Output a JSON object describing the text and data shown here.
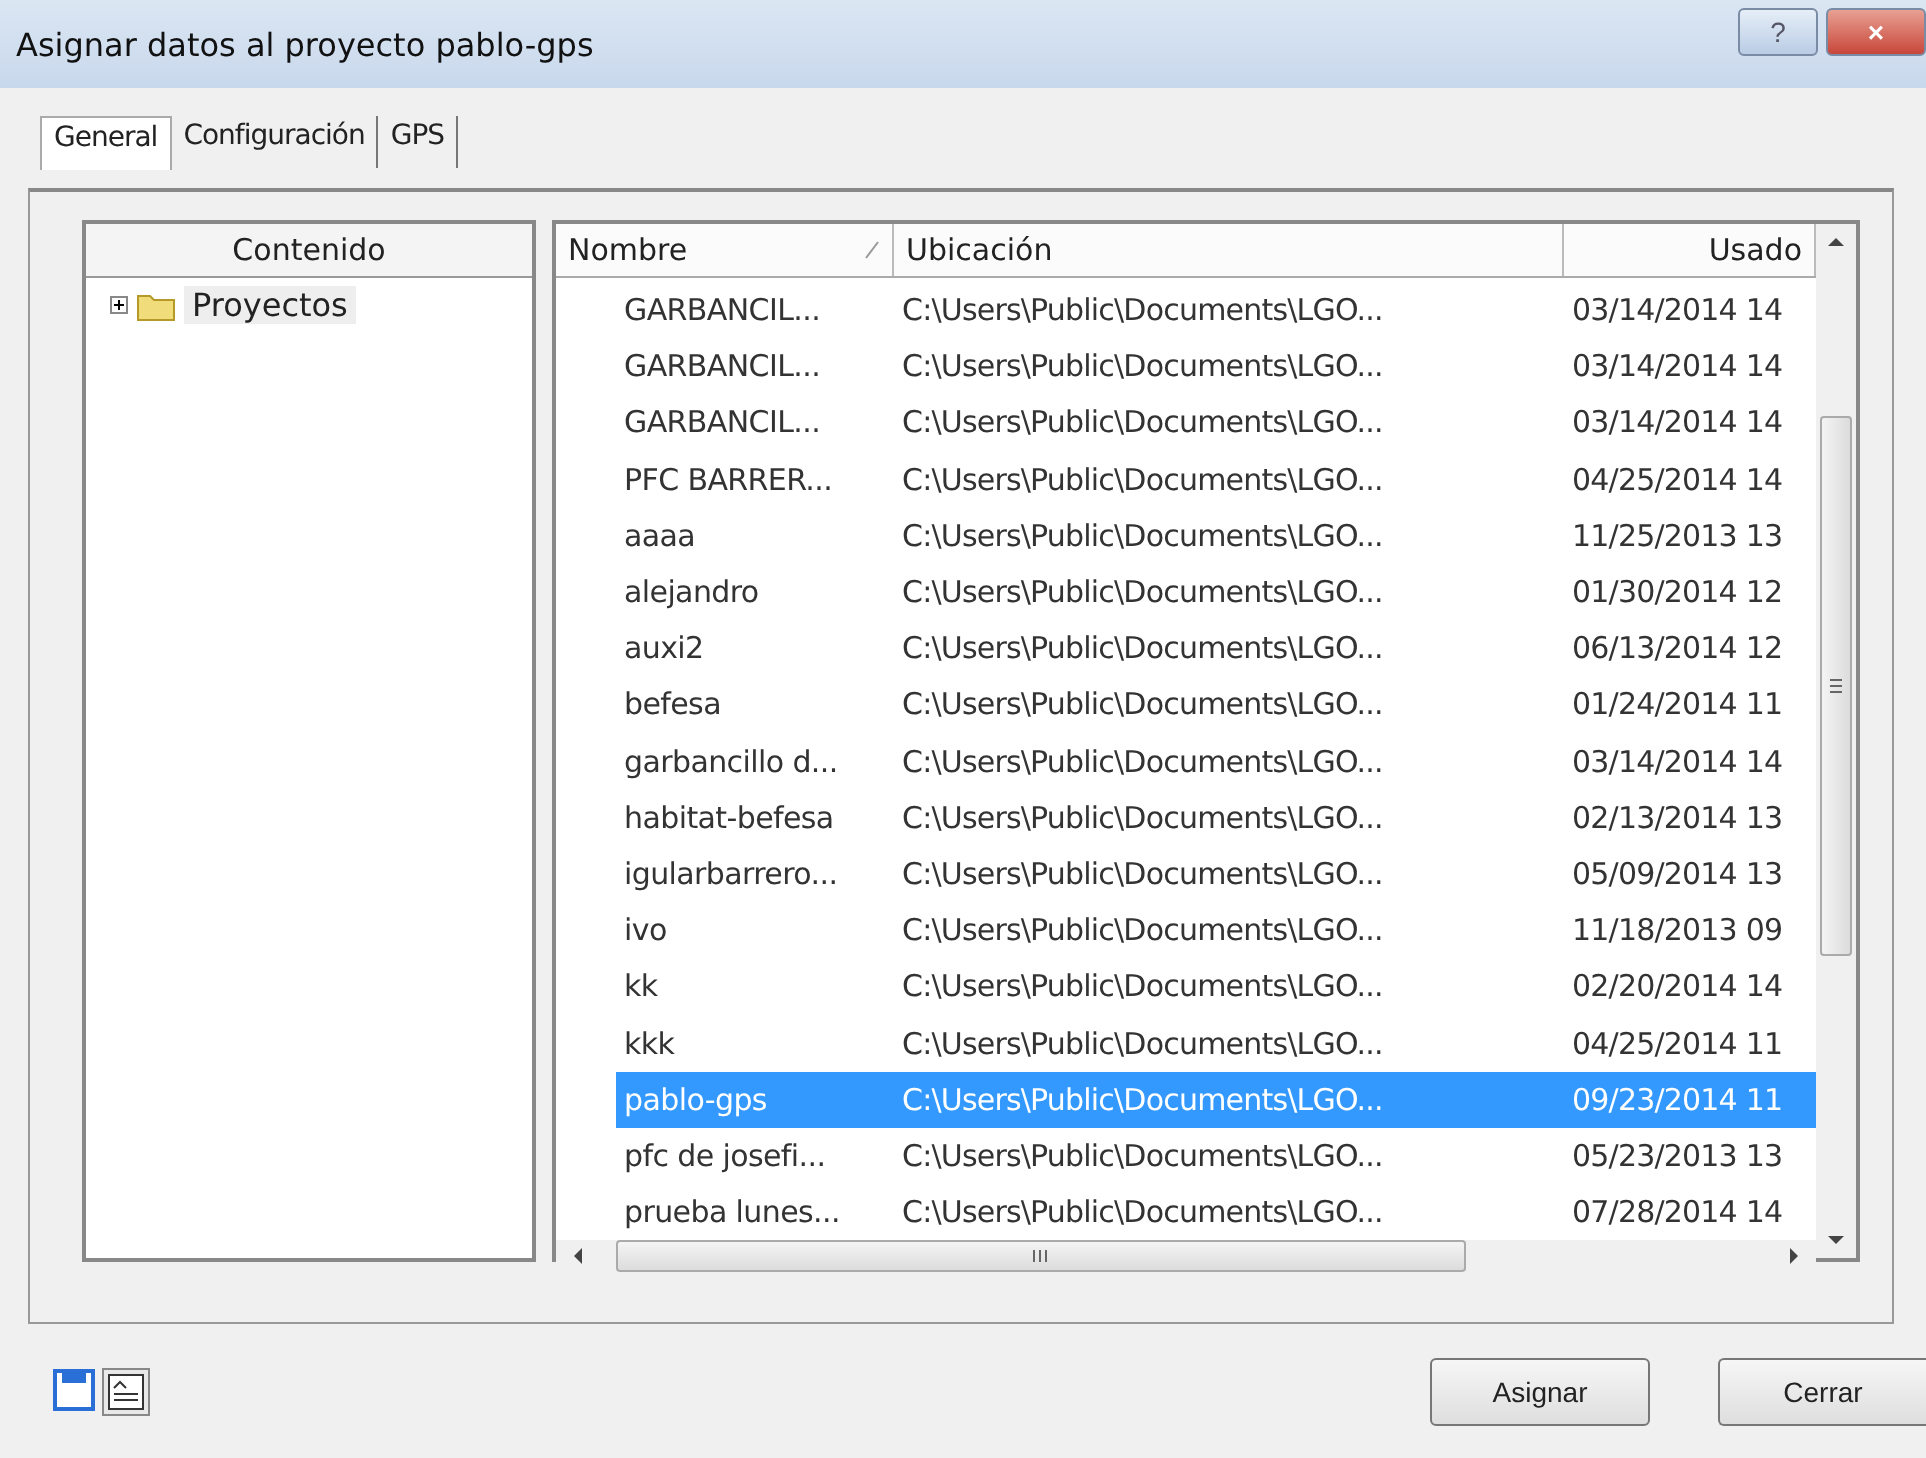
{
  "window": {
    "title": "Asignar datos al proyecto pablo-gps",
    "buttons": [
      {
        "kind": "help",
        "label": "?"
      },
      {
        "kind": "close",
        "label": "×"
      }
    ]
  },
  "tabs": [
    {
      "label": "General",
      "selected": true
    },
    {
      "label": "Configuración",
      "selected": false
    },
    {
      "label": "GPS",
      "selected": false
    }
  ],
  "tree": {
    "column": "Contenido",
    "items": [
      {
        "label": "Proyectos",
        "expanded": false
      }
    ]
  },
  "table": {
    "columns": [
      {
        "label": "Nombre",
        "sorted": true
      },
      {
        "label": "Ubicación",
        "sorted": false
      },
      {
        "label": "Usado",
        "sorted": false
      }
    ],
    "rows": [
      {
        "cells": [
          "GARBANCIL...",
          "C:\\Users\\Public\\Documents\\LGO...",
          "03/14/2014 14"
        ],
        "selected": false
      },
      {
        "cells": [
          "GARBANCIL...",
          "C:\\Users\\Public\\Documents\\LGO...",
          "03/14/2014 14"
        ],
        "selected": false
      },
      {
        "cells": [
          "GARBANCIL...",
          "C:\\Users\\Public\\Documents\\LGO...",
          "03/14/2014 14"
        ],
        "selected": false
      },
      {
        "cells": [
          "PFC BARRER...",
          "C:\\Users\\Public\\Documents\\LGO...",
          "04/25/2014 14"
        ],
        "selected": false
      },
      {
        "cells": [
          "aaaa",
          "C:\\Users\\Public\\Documents\\LGO...",
          "11/25/2013 13"
        ],
        "selected": false
      },
      {
        "cells": [
          "alejandro",
          "C:\\Users\\Public\\Documents\\LGO...",
          "01/30/2014 12"
        ],
        "selected": false
      },
      {
        "cells": [
          "auxi2",
          "C:\\Users\\Public\\Documents\\LGO...",
          "06/13/2014 12"
        ],
        "selected": false
      },
      {
        "cells": [
          "befesa",
          "C:\\Users\\Public\\Documents\\LGO...",
          "01/24/2014 11"
        ],
        "selected": false
      },
      {
        "cells": [
          "garbancillo d...",
          "C:\\Users\\Public\\Documents\\LGO...",
          "03/14/2014 14"
        ],
        "selected": false
      },
      {
        "cells": [
          "habitat-befesa",
          "C:\\Users\\Public\\Documents\\LGO...",
          "02/13/2014 13"
        ],
        "selected": false
      },
      {
        "cells": [
          "igularbarrero...",
          "C:\\Users\\Public\\Documents\\LGO...",
          "05/09/2014 13"
        ],
        "selected": false
      },
      {
        "cells": [
          "ivo",
          "C:\\Users\\Public\\Documents\\LGO...",
          "11/18/2013 09"
        ],
        "selected": false
      },
      {
        "cells": [
          "kk",
          "C:\\Users\\Public\\Documents\\LGO...",
          "02/20/2014 14"
        ],
        "selected": false
      },
      {
        "cells": [
          "kkk",
          "C:\\Users\\Public\\Documents\\LGO...",
          "04/25/2014 11"
        ],
        "selected": false
      },
      {
        "cells": [
          "pablo-gps",
          "C:\\Users\\Public\\Documents\\LGO...",
          "09/23/2014 11"
        ],
        "selected": true
      },
      {
        "cells": [
          "pfc de josefi...",
          "C:\\Users\\Public\\Documents\\LGO...",
          "05/23/2013 13"
        ],
        "selected": false
      },
      {
        "cells": [
          "prueba lunes...",
          "C:\\Users\\Public\\Documents\\LGO...",
          "07/28/2014 14"
        ],
        "selected": false
      }
    ]
  },
  "footer": {
    "tools": [
      {
        "kind": "save"
      },
      {
        "kind": "properties"
      }
    ],
    "buttons": [
      "Asignar",
      "Cerrar"
    ]
  }
}
